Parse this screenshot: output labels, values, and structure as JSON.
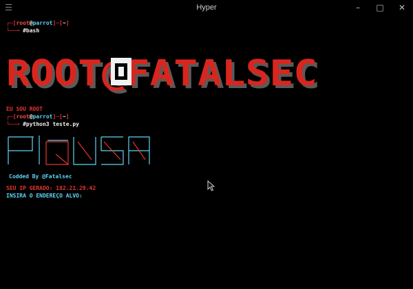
{
  "window": {
    "title": "Hyper",
    "controls": [
      "–",
      "□",
      "✕"
    ]
  },
  "terminal": {
    "prompt1": {
      "corner": "┌─",
      "open_bracket": "[",
      "user": "root",
      "at": "@",
      "host": "parrot",
      "close_bracket": "]",
      "dash": "─",
      "path_open": "[",
      "path": "~",
      "path_close": "]",
      "lead": "└──╼ ",
      "command": "#bash"
    },
    "banner_text": "ROOT@FATALSEC",
    "eu_sou_root": "EU SOU ROOT",
    "prompt2": {
      "corner": "┌─",
      "open_bracket": "[",
      "user": "root",
      "at": "@",
      "host": "parrot",
      "close_bracket": "]",
      "dash": "─",
      "path_open": "[",
      "path": "~",
      "path_close": "]",
      "lead": "└──╼ ",
      "command": "#python3 teste.py"
    },
    "ascii_art_label": "PIQUSA",
    "codded_by_prefix": "Codded By ",
    "codded_by_author": "@Fatalsec",
    "ip_label": "SEU IP GERADO: ",
    "ip_value": "182.21.29.42",
    "target_prompt": "INSIRA O ENDEREÇO ALVO:"
  },
  "colors": {
    "background": "#000000",
    "banner_red": "#d8261f",
    "prompt_red": "#e8342f",
    "cyan": "#5fd7f7",
    "white": "#f2f2f2"
  }
}
